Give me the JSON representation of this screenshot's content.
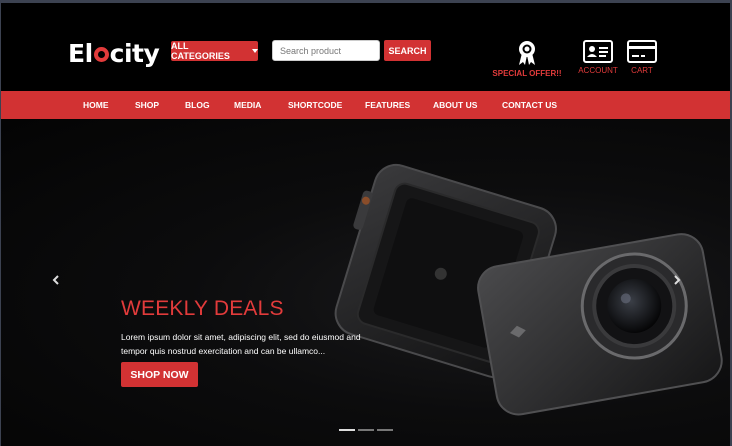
{
  "header": {
    "logo_prefix": "El",
    "logo_suffix": "city",
    "categories_label": "All Categories",
    "search": {
      "placeholder": "Search product",
      "button_label": "SEARCH"
    },
    "special_offer_label": "SPECIAL OFFER!!",
    "account_label": "ACCOUNT",
    "cart_label": "CART"
  },
  "nav": {
    "items": [
      "HOME",
      "SHOP",
      "BLOG",
      "MEDIA",
      "SHORTCODE",
      "FEATURES",
      "ABOUT US",
      "CONTACT US"
    ]
  },
  "hero": {
    "title": "WEEKLY DEALS",
    "text": "Lorem ipsum dolor sit amet, adipiscing elit, sed do eiusmod and tempor quis nostrud exercitation and can be ullamco...",
    "button_label": "SHOP NOW",
    "slides_total": 3,
    "active_slide": 1
  },
  "colors": {
    "accent": "#d23233",
    "background": "#000000"
  },
  "icons": [
    "caret-down-icon",
    "award-ribbon-icon",
    "id-card-icon",
    "credit-card-icon",
    "chevron-left-icon",
    "chevron-right-icon"
  ]
}
